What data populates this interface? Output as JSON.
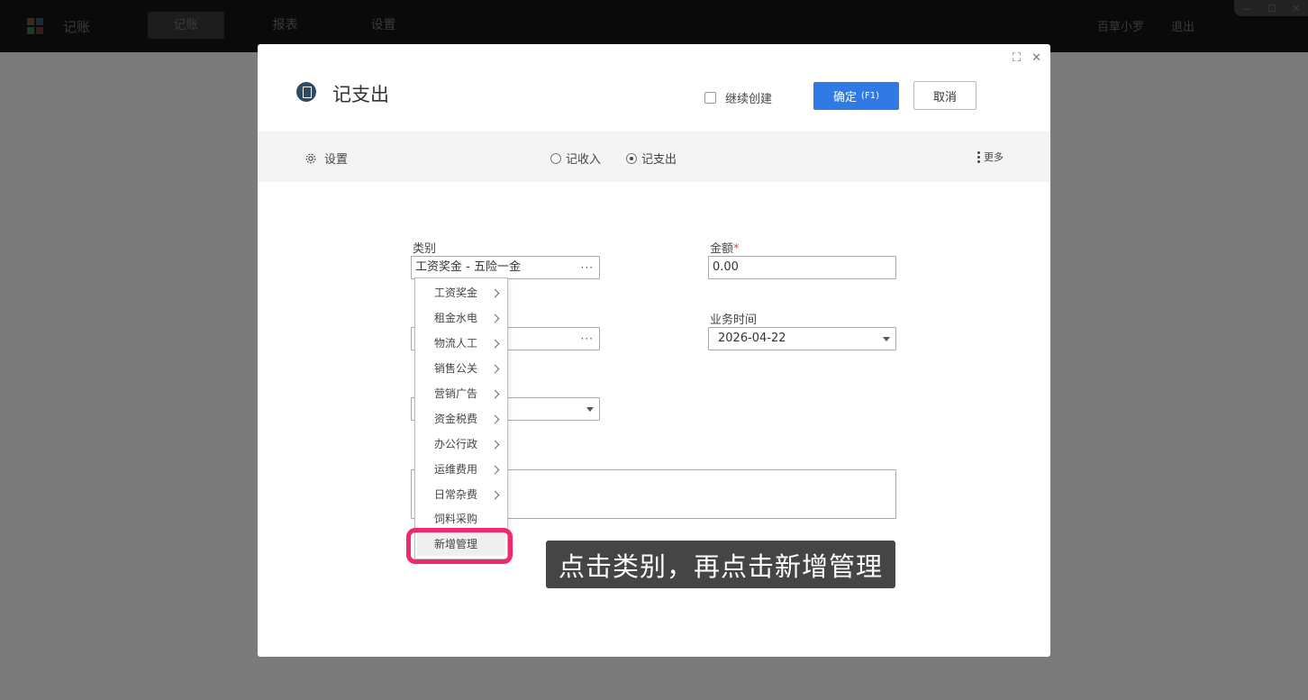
{
  "app": {
    "title": "记账",
    "nav": [
      {
        "label": "记账",
        "active": true
      },
      {
        "label": "报表",
        "active": false
      },
      {
        "label": "设置",
        "active": false
      }
    ],
    "user": "百草小罗",
    "logout": "退出"
  },
  "dialog": {
    "title": "记支出",
    "keep_creating_label": "继续创建",
    "keep_creating_checked": false,
    "confirm_label": "确定",
    "confirm_shortcut": "(F1)",
    "cancel_label": "取消"
  },
  "toolbar": {
    "settings_label": "设置",
    "radio_income_label": "记收入",
    "radio_expense_label": "记支出",
    "selected": "expense",
    "more_label": "更多"
  },
  "form": {
    "category_label": "类别",
    "category_value": "工资奖金 - 五险一金",
    "amount_label": "金额",
    "amount_required_mark": "*",
    "amount_value": "0.00",
    "business_time_label": "业务时间",
    "business_time_value": "2026-04-22"
  },
  "category_menu": {
    "items": [
      {
        "label": "工资奖金",
        "has_submenu": true
      },
      {
        "label": "租金水电",
        "has_submenu": true
      },
      {
        "label": "物流人工",
        "has_submenu": true
      },
      {
        "label": "销售公关",
        "has_submenu": true
      },
      {
        "label": "营销广告",
        "has_submenu": true
      },
      {
        "label": "资金税费",
        "has_submenu": true
      },
      {
        "label": "办公行政",
        "has_submenu": true
      },
      {
        "label": "运维费用",
        "has_submenu": true
      },
      {
        "label": "日常杂费",
        "has_submenu": true
      },
      {
        "label": "饲料采购",
        "has_submenu": false
      }
    ],
    "add_manage_label": "新增管理"
  },
  "tutorial_caption": "点击类别，再点击新增管理",
  "colors": {
    "primary": "#2f7ae5",
    "highlight": "#f2286f",
    "required": "#e0453b"
  }
}
